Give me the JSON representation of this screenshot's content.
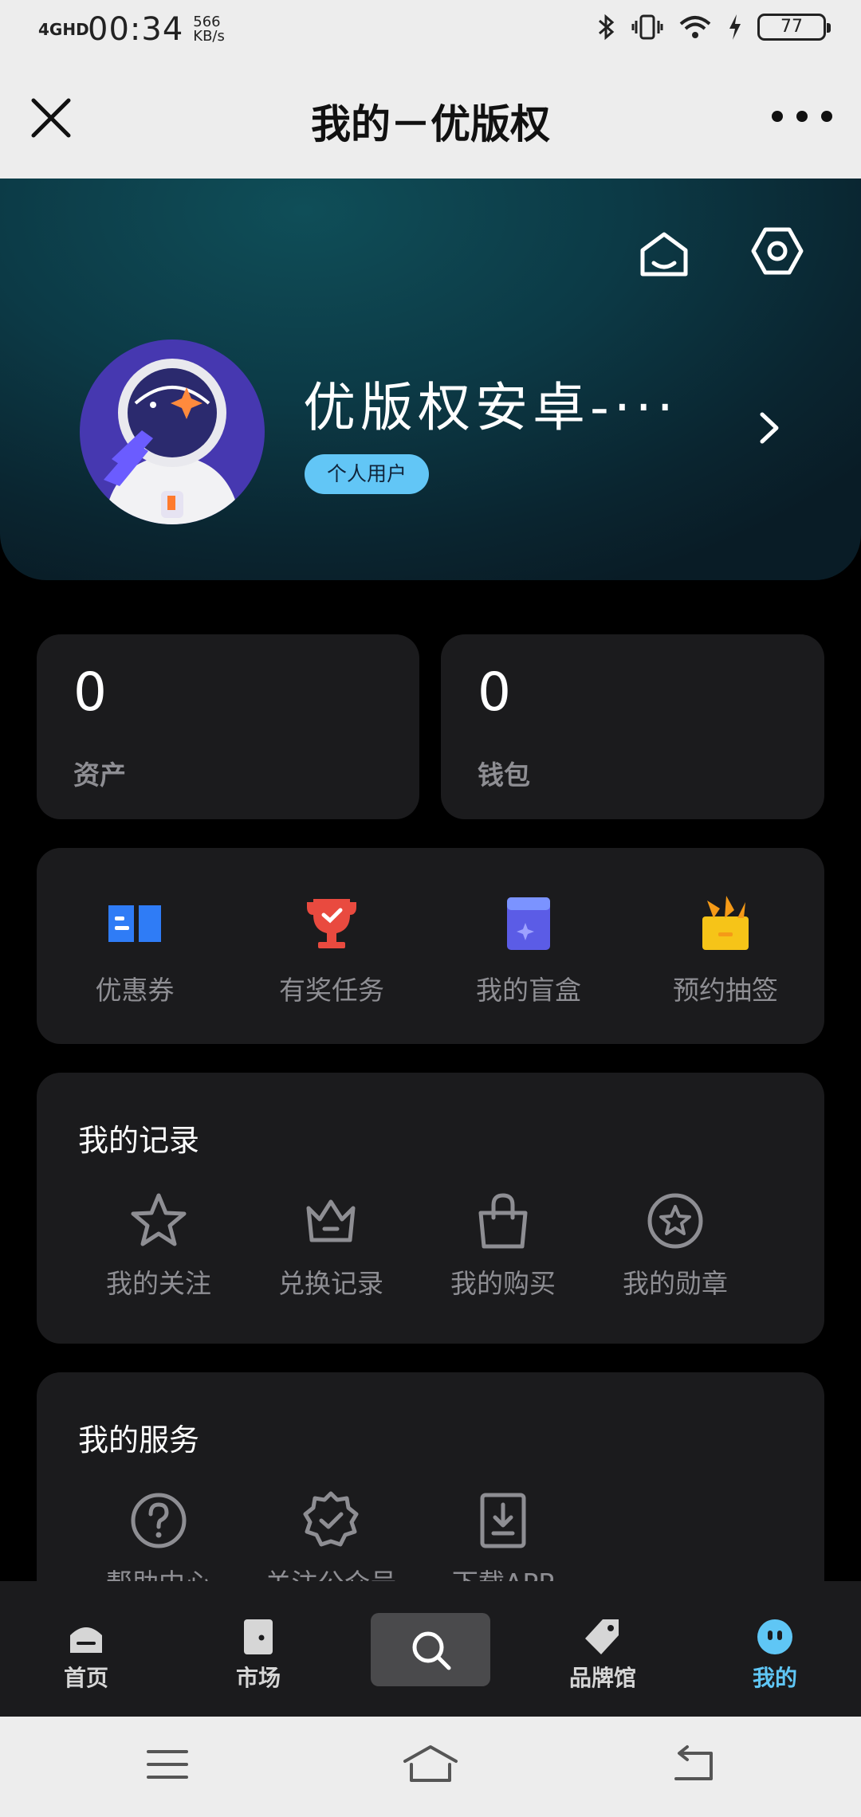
{
  "status_bar": {
    "network": "4GHD",
    "time": "00:34",
    "speed": "566 KB/s",
    "battery": "77"
  },
  "title_bar": {
    "title": "我的－优版权"
  },
  "profile": {
    "username": "优版权安卓-···",
    "badge": "个人用户"
  },
  "stats": [
    {
      "value": "0",
      "label": "资产"
    },
    {
      "value": "0",
      "label": "钱包"
    }
  ],
  "quick_actions": [
    {
      "label": "优惠券",
      "icon": "coupon-icon",
      "color": "#2f7cf6"
    },
    {
      "label": "有奖任务",
      "icon": "trophy-icon",
      "color": "#e94a3f"
    },
    {
      "label": "我的盲盒",
      "icon": "blindbox-icon",
      "color": "#5b5ce6"
    },
    {
      "label": "预约抽签",
      "icon": "gift-icon",
      "color": "#f6c418"
    }
  ],
  "records": {
    "title": "我的记录",
    "items": [
      {
        "label": "我的关注",
        "icon": "star-icon"
      },
      {
        "label": "兑换记录",
        "icon": "crown-icon"
      },
      {
        "label": "我的购买",
        "icon": "bag-icon"
      },
      {
        "label": "我的勋章",
        "icon": "medal-icon"
      }
    ]
  },
  "services": {
    "title": "我的服务",
    "items": [
      {
        "label": "帮助中心",
        "icon": "help-icon"
      },
      {
        "label": "关注公众号",
        "icon": "verified-icon"
      },
      {
        "label": "下载APP",
        "icon": "download-icon"
      }
    ]
  },
  "tabs": [
    {
      "label": "首页",
      "icon": "home-icon"
    },
    {
      "label": "市场",
      "icon": "market-icon"
    },
    {
      "label": "",
      "icon": "search-icon"
    },
    {
      "label": "品牌馆",
      "icon": "tag-icon"
    },
    {
      "label": "我的",
      "icon": "profile-icon",
      "active": true
    }
  ],
  "colors": {
    "accent": "#5fc6f5",
    "card_bg": "#1b1b1d",
    "muted_text": "#8e8e93"
  }
}
